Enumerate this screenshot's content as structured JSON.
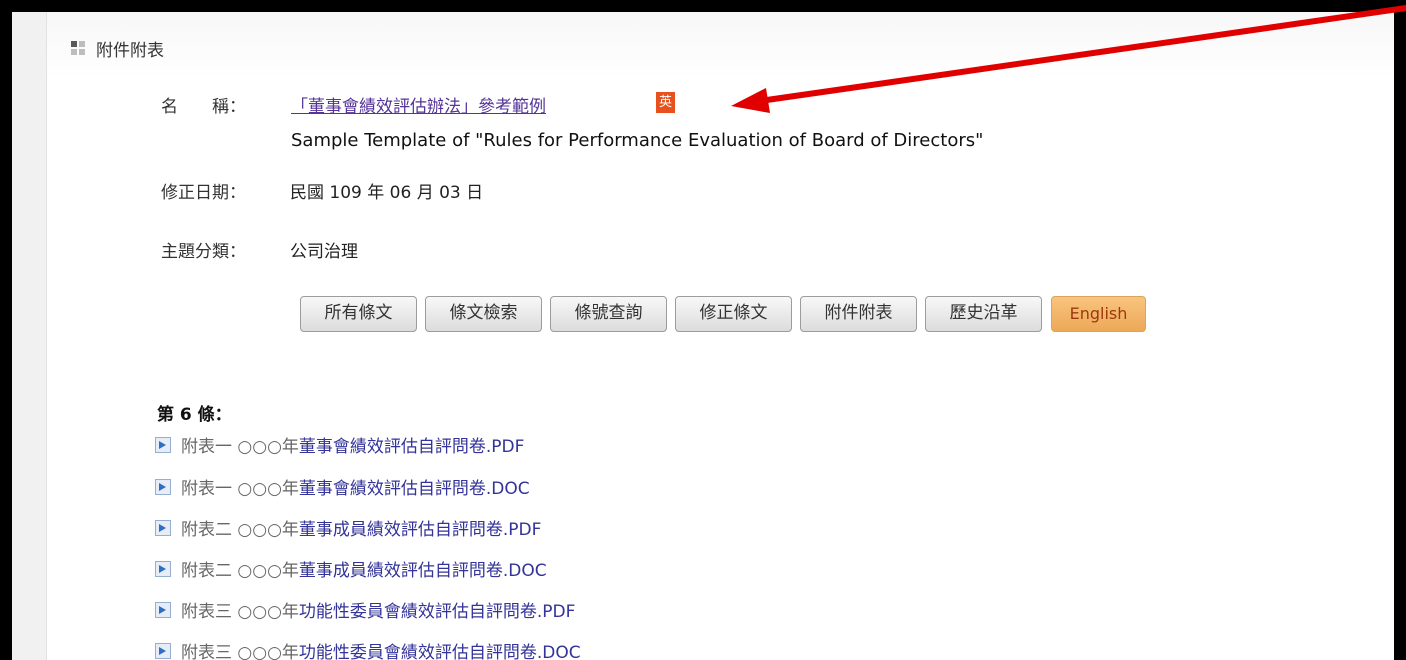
{
  "header": {
    "title": "附件附表"
  },
  "info": {
    "name_label": "名　　稱：",
    "name_value": "「董事會績效評估辦法」參考範例",
    "english_badge": "英",
    "subtitle": "Sample Template of \"Rules for Performance Evaluation of Board of Directors\"",
    "date_label": "修正日期：",
    "date_value": "民國 109 年 06 月 03 日",
    "category_label": "主題分類：",
    "category_value": "公司治理"
  },
  "buttons": {
    "all_articles": "所有條文",
    "article_search": "條文檢索",
    "article_number_lookup": "條號查詢",
    "amended_articles": "修正條文",
    "attachments": "附件附表",
    "history": "歷史沿革",
    "english": "English"
  },
  "attachments": {
    "article_title": "第 6 條：",
    "files": [
      {
        "prefix": "附表一 ○○○年",
        "name": "董事會績效評估自評問卷.PDF"
      },
      {
        "prefix": "附表一 ○○○年",
        "name": "董事會績效評估自評問卷.DOC"
      },
      {
        "prefix": "附表二 ○○○年",
        "name": "董事成員績效評估自評問卷.PDF"
      },
      {
        "prefix": "附表二 ○○○年",
        "name": "董事成員績效評估自評問卷.DOC"
      },
      {
        "prefix": "附表三 ○○○年",
        "name": "功能性委員會績效評估自評問卷.PDF"
      },
      {
        "prefix": "附表三 ○○○年",
        "name": "功能性委員會績效評估自評問卷.DOC"
      }
    ]
  },
  "colors": {
    "annotation_arrow": "#e00000",
    "link": "#553399",
    "badge": "#e8501e",
    "english_button": "#f0b062"
  },
  "icons": {
    "header": "section-grid-icon",
    "file": "file-arrow-icon",
    "annotation": "red-arrow-annotation"
  }
}
